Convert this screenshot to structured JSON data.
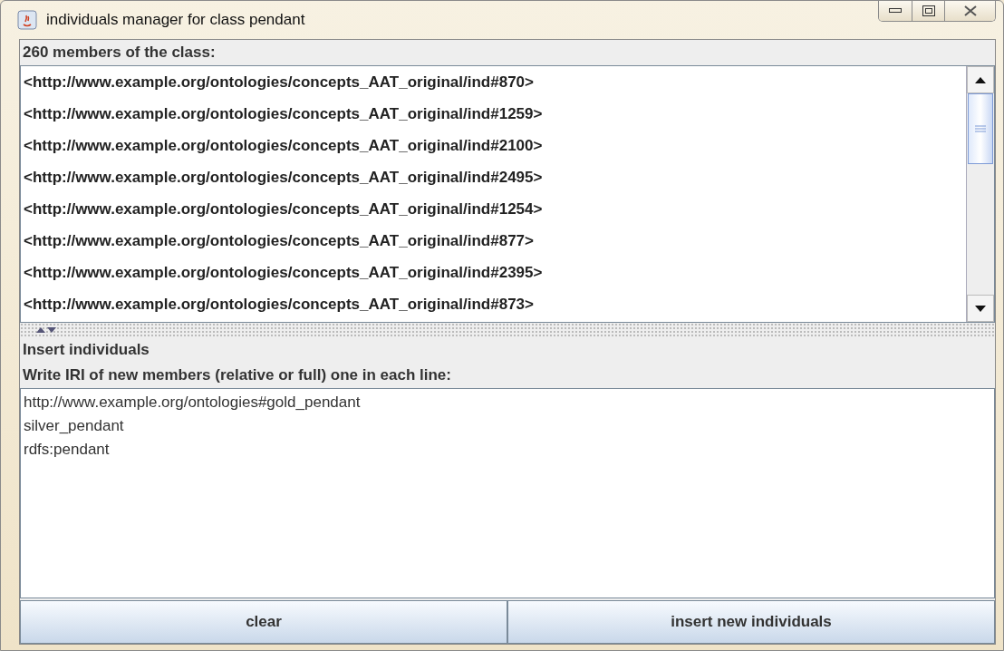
{
  "window": {
    "title": "individuals manager for class pendant"
  },
  "members": {
    "label": "260 members of the class:",
    "items": [
      "<http://www.example.org/ontologies/concepts_AAT_original/ind#870>",
      "<http://www.example.org/ontologies/concepts_AAT_original/ind#1259>",
      "<http://www.example.org/ontologies/concepts_AAT_original/ind#2100>",
      "<http://www.example.org/ontologies/concepts_AAT_original/ind#2495>",
      "<http://www.example.org/ontologies/concepts_AAT_original/ind#1254>",
      "<http://www.example.org/ontologies/concepts_AAT_original/ind#877>",
      "<http://www.example.org/ontologies/concepts_AAT_original/ind#2395>",
      "<http://www.example.org/ontologies/concepts_AAT_original/ind#873>"
    ]
  },
  "insert": {
    "title": "Insert individuals",
    "instructions": "Write IRI of new members (relative or full) one in each line:",
    "value": "http://www.example.org/ontologies#gold_pendant\nsilver_pendant\nrdfs:pendant"
  },
  "buttons": [
    "clear",
    "insert new individuals"
  ]
}
